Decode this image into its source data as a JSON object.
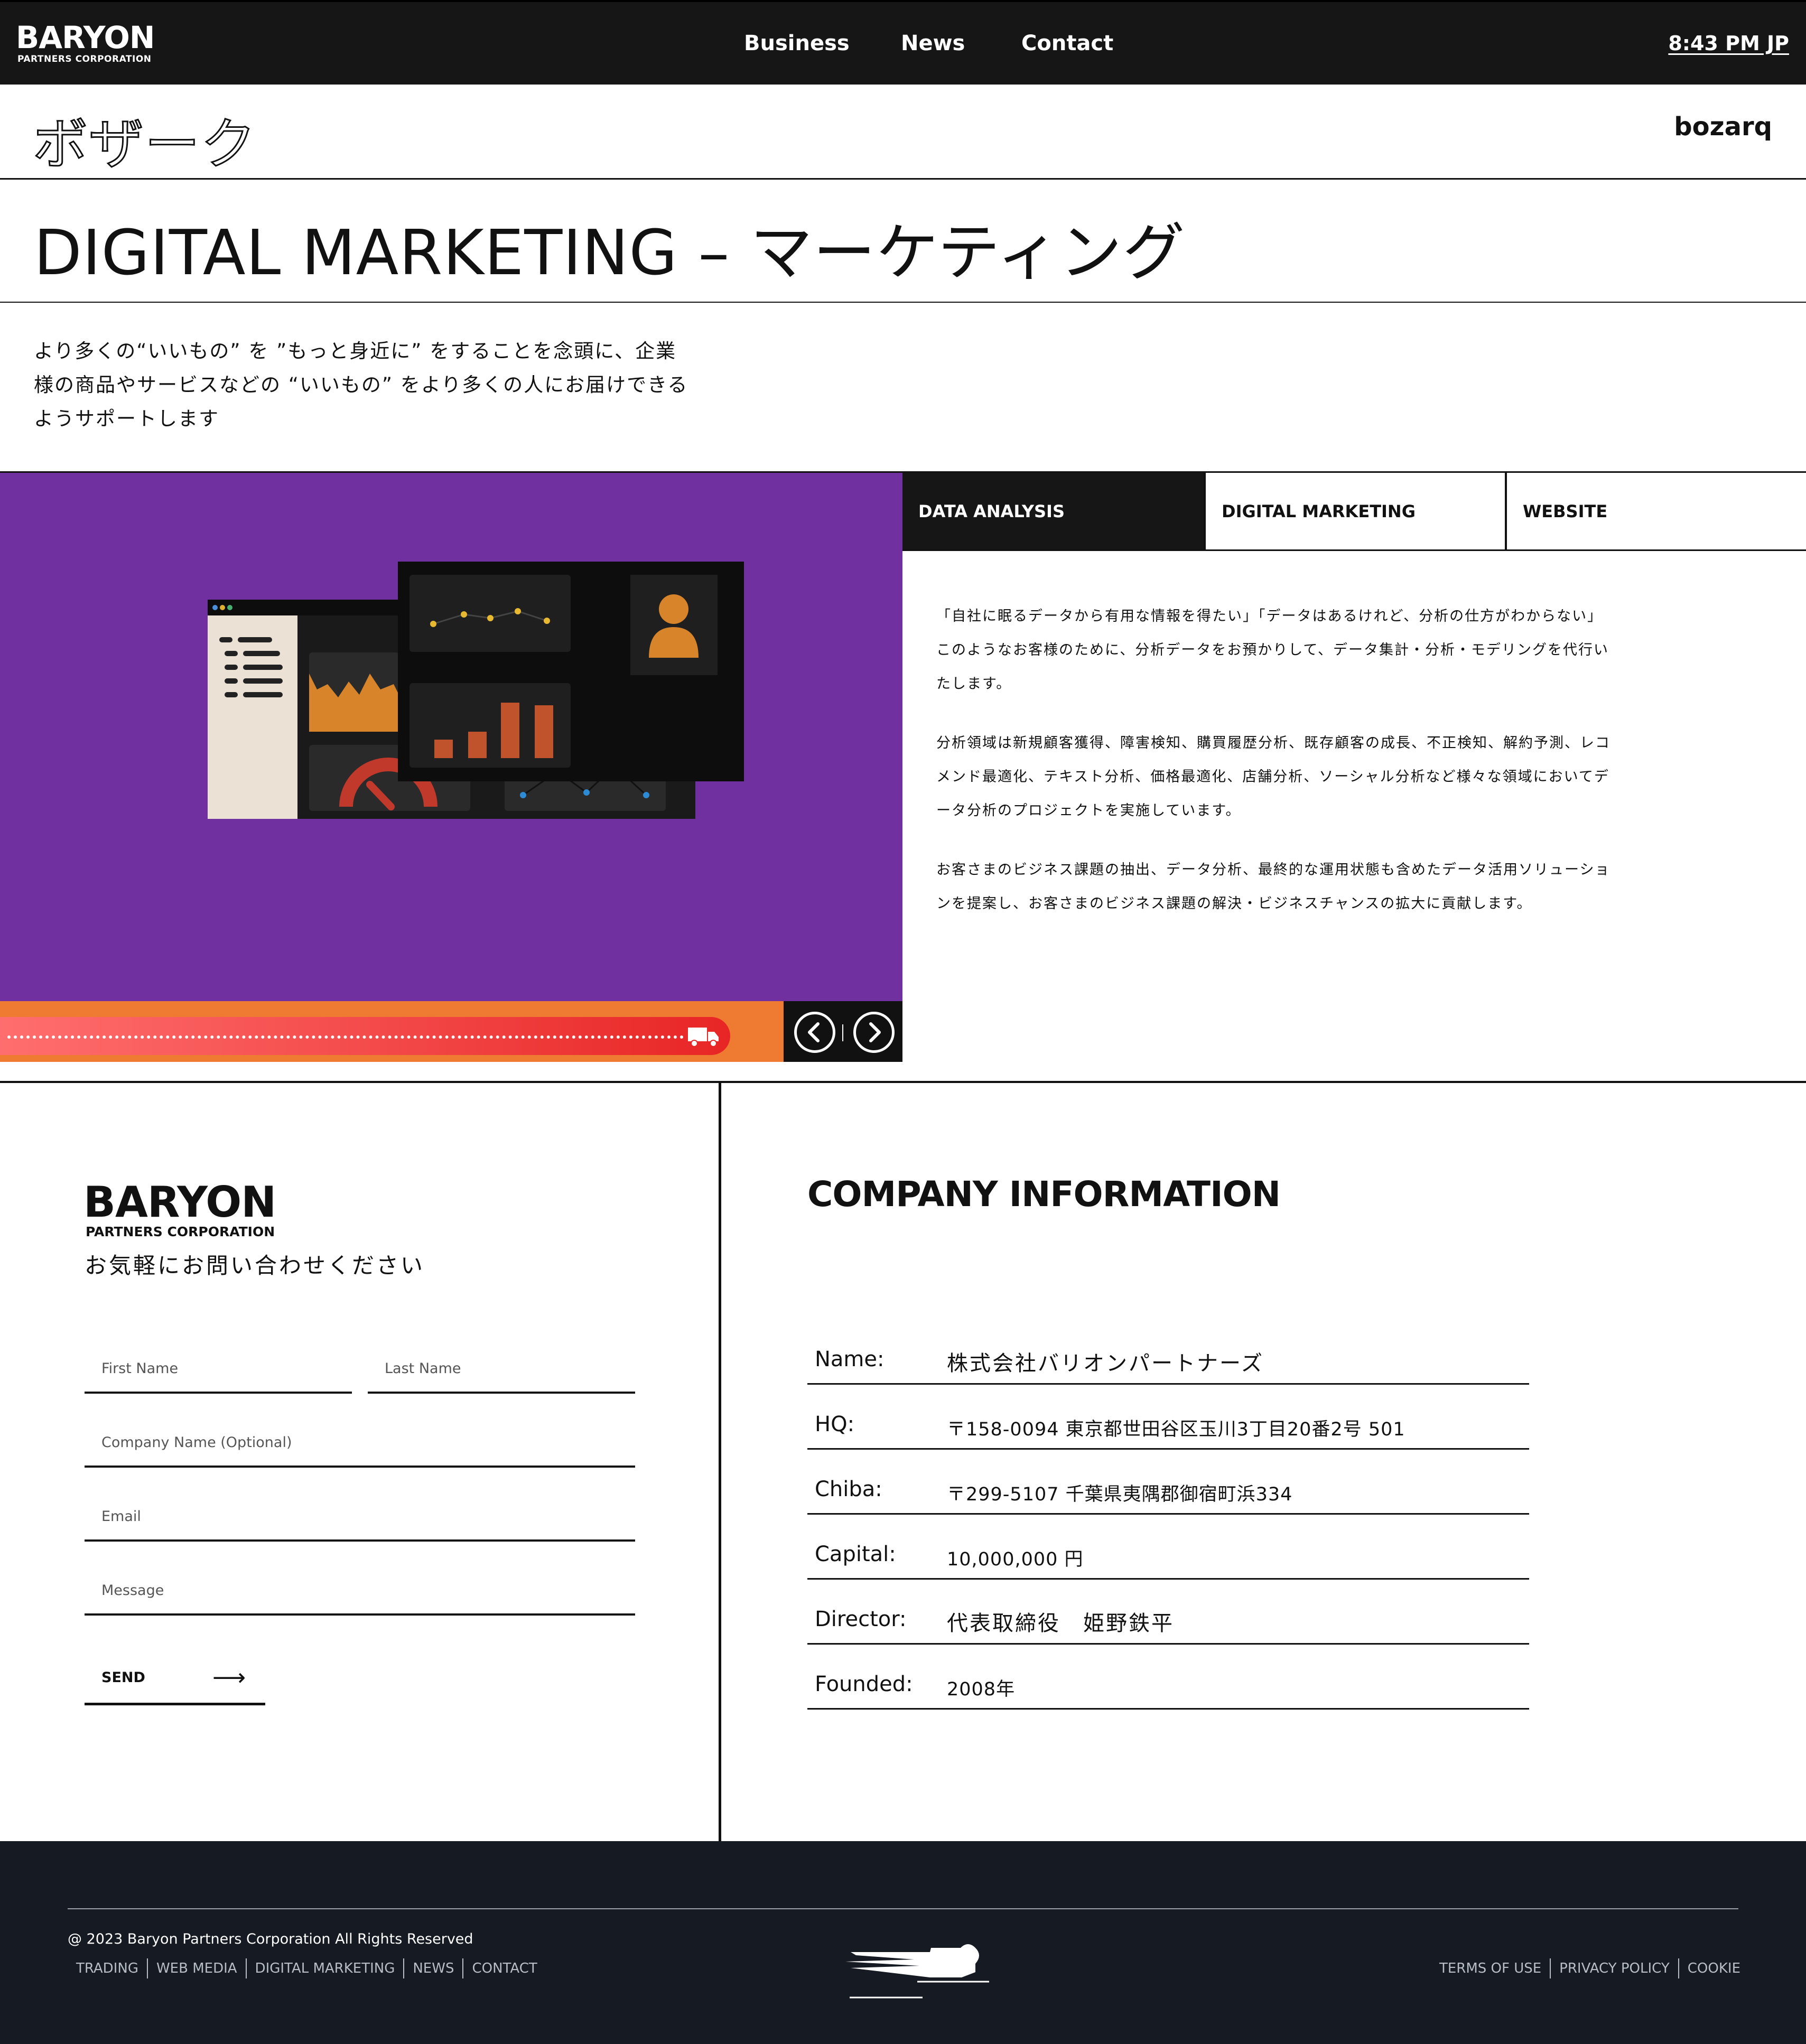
{
  "header": {
    "logo_main": "BARYON",
    "logo_sub": "PARTNERS CORPORATION",
    "nav": {
      "business": "Business",
      "news": "News",
      "contact": "Contact"
    },
    "clock": "8:43 PM JP"
  },
  "subbrand": {
    "kana_logo": "ボザーク",
    "wordmark": "bozarq"
  },
  "page_title": "DIGITAL MARKETING – マーケティング",
  "intro": "より多くの“いいもの” を ”もっと身近に” をすることを念頭に、企業様の商品やサービスなどの “いいもの” をより多くの人にお届けできるようサポートします",
  "services": {
    "tabs": [
      {
        "label": "DATA ANALYSIS",
        "active": true
      },
      {
        "label": "DIGITAL MARKETING",
        "active": false
      },
      {
        "label": "WEBSITE",
        "active": false
      }
    ],
    "body": [
      "「自社に眠るデータから有用な情報を得たい」「データはあるけれど、分析の仕方がわからない」 このようなお客様のために、分析データをお預かりして、データ集計・分析・モデリングを代行いたします。",
      "分析領域は新規顧客獲得、障害検知、購買履歴分析、既存顧客の成長、不正検知、解約予測、レコメンド最適化、テキスト分析、価格最適化、店舗分析、ソーシャル分析など様々な領域においてデータ分析のプロジェクトを実施しています。",
      "お客さまのビジネス課題の抽出、データ分析、最終的な運用状態も含めたデータ活用ソリューションを提案し、お客さまのビジネス課題の解決・ビジネスチャンスの拡大に貢献します。"
    ],
    "media": {
      "background_color": "#7030a0",
      "progress_fraction": 1.0,
      "progress_color": "#ef7b33",
      "icons": [
        "dashboard-illustration",
        "truck-icon",
        "chevron-left-icon",
        "chevron-right-icon"
      ]
    }
  },
  "contact": {
    "logo_main": "BARYON",
    "logo_sub": "PARTNERS CORPORATION",
    "lead": "お気軽にお問い合わせください",
    "form": {
      "first_name_placeholder": "First Name",
      "last_name_placeholder": "Last Name",
      "company_placeholder": "Company Name (Optional)",
      "email_placeholder": "Email",
      "message_placeholder": "Message",
      "send_label": "SEND",
      "send_arrow": "⟶"
    }
  },
  "company_info": {
    "title": "COMPANY INFORMATION",
    "rows": [
      {
        "key": "Name:",
        "value": "株式会社バリオンパートナーズ"
      },
      {
        "key": "HQ:",
        "value": "〒158-0094 東京都世田谷区玉川3丁目20番2号 501"
      },
      {
        "key": "Chiba:",
        "value": "〒299-5107 千葉県夷隅郡御宿町浜334"
      },
      {
        "key": "Capital:",
        "value": "10,000,000 円"
      },
      {
        "key": "Director:",
        "value": "代表取締役　姫野鉄平"
      },
      {
        "key": "Founded:",
        "value": "2008年"
      }
    ]
  },
  "footer": {
    "copyright": "@ 2023 Baryon Partners Corporation All Rights Reserved",
    "links_left": [
      "TRADING",
      "WEB MEDIA",
      "DIGITAL MARKETING",
      "NEWS",
      "CONTACT"
    ],
    "links_right": [
      "TERMS OF USE",
      "PRIVACY POLICY",
      "COOKIE"
    ]
  },
  "colors": {
    "header_bg": "#161616",
    "footer_bg": "#161a22",
    "accent_purple": "#7030a0",
    "accent_orange": "#ef7b33",
    "progress_red": "#e82525"
  }
}
